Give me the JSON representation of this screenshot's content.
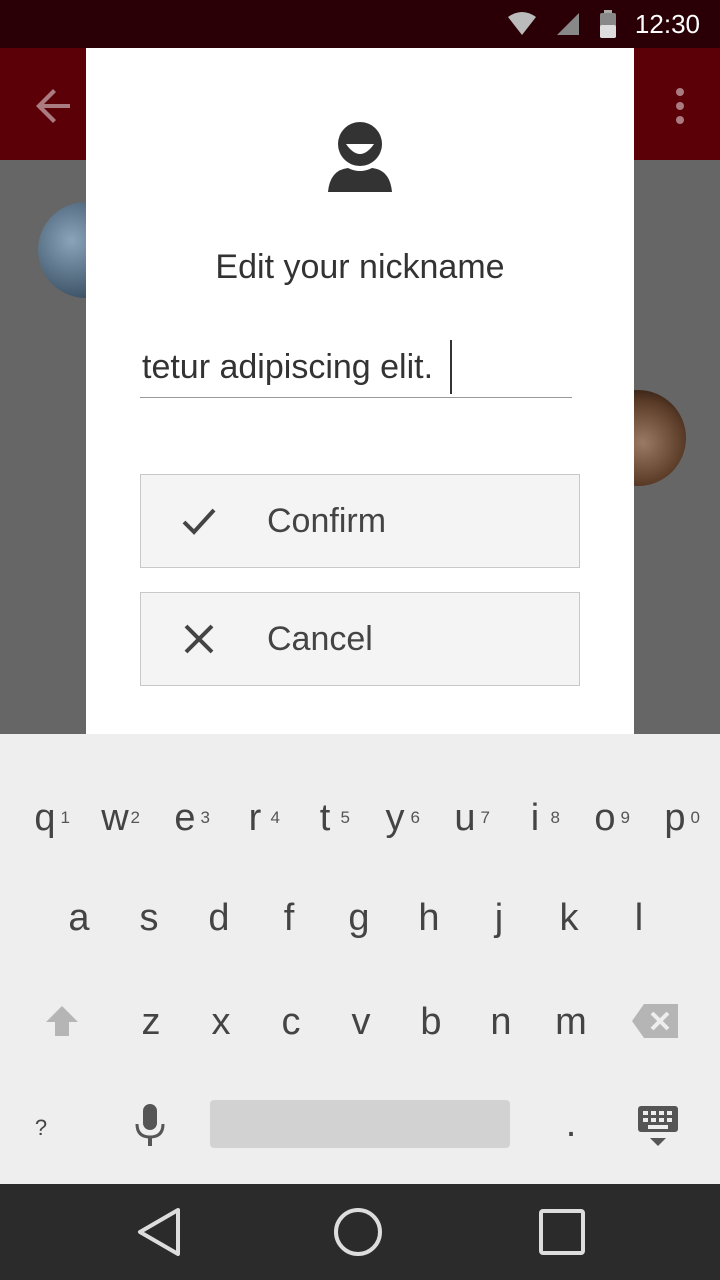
{
  "status_bar": {
    "time": "12:30"
  },
  "dialog": {
    "title": "Edit your nickname",
    "input_value": "tetur adipiscing elit.",
    "confirm_label": "Confirm",
    "cancel_label": "Cancel"
  },
  "keyboard": {
    "row1": [
      {
        "key": "q",
        "hint": "1"
      },
      {
        "key": "w",
        "hint": "2"
      },
      {
        "key": "e",
        "hint": "3"
      },
      {
        "key": "r",
        "hint": "4"
      },
      {
        "key": "t",
        "hint": "5"
      },
      {
        "key": "y",
        "hint": "6"
      },
      {
        "key": "u",
        "hint": "7"
      },
      {
        "key": "i",
        "hint": "8"
      },
      {
        "key": "o",
        "hint": "9"
      },
      {
        "key": "p",
        "hint": "0"
      }
    ],
    "row2": [
      "a",
      "s",
      "d",
      "f",
      "g",
      "h",
      "j",
      "k",
      "l"
    ],
    "row3": [
      "z",
      "x",
      "c",
      "v",
      "b",
      "n",
      "m"
    ],
    "symbols_key": "?",
    "period_key": "."
  },
  "colors": {
    "status_bar": "#2a0006",
    "app_bar": "#5c0007",
    "dialog_bg": "#ffffff",
    "button_bg": "#f4f4f4"
  }
}
